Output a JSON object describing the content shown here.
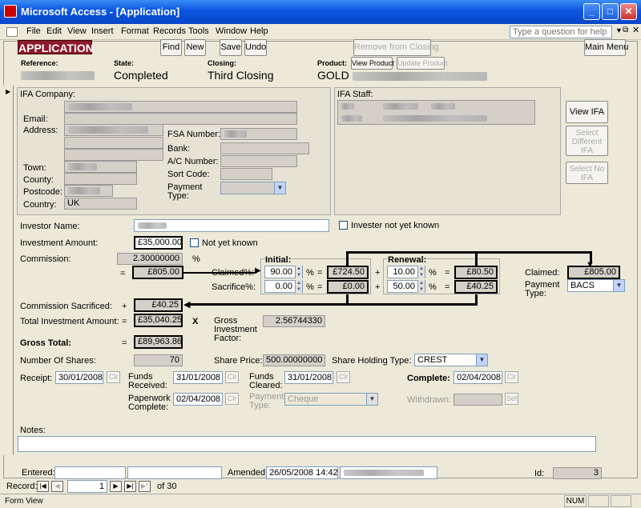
{
  "window": {
    "title": "Microsoft Access - [Application]"
  },
  "menu": [
    "File",
    "Edit",
    "View",
    "Insert",
    "Format",
    "Records",
    "Tools",
    "Window",
    "Help"
  ],
  "help_placeholder": "Type a question for help",
  "header": {
    "form_title": "APPLICATION",
    "find": "Find",
    "new": "New",
    "save": "Save",
    "undo": "Undo",
    "remove_closing": "Remove from Closing",
    "main_menu": "Main Menu",
    "reference_label": "Reference:",
    "reference_value": "GOLD1E5B08(1",
    "state_label": "State:",
    "state_value": "Completed",
    "closing_label": "Closing:",
    "closing_value": "Third Closing",
    "product_label": "Product:",
    "view_product": "View Product",
    "update_product": "Update Product",
    "product_value": "GOLD"
  },
  "ifa": {
    "company_label": "IFA Company:",
    "email_label": "Email:",
    "address_label": "Address:",
    "town_label": "Town:",
    "county_label": "County:",
    "postcode_label": "Postcode:",
    "country_label": "Country:",
    "country_value": "UK",
    "fsa_label": "FSA Number:",
    "bank_label": "Bank:",
    "ac_label": "A/C Number:",
    "sort_label": "Sort Code:",
    "payment_label": "Payment Type:",
    "staff_label": "IFA Staff:",
    "view_ifa": "View IFA",
    "select_diff": "Select Different IFA",
    "select_no": "Select No IFA"
  },
  "investor": {
    "name_label": "Investor Name:",
    "not_known": "Invester not yet known",
    "amount_label": "Investment Amount:",
    "amount_value": "£35,000.00",
    "amount_not_known": "Not yet known",
    "commission_label": "Commission:",
    "commission_value": "2.30000000",
    "percent": "%",
    "commission_amount": "£805.00",
    "eq": "=",
    "plus": "+",
    "x": "X",
    "claimed_pct_label": "Claimed%:",
    "sacrifice_pct_label": "Sacrifice%:",
    "initial_label": "Initial:",
    "renewal_label": "Renewal:",
    "init_claimed_pct": "90.00",
    "init_claimed_amt": "£724.50",
    "init_sac_pct": "0.00",
    "init_sac_amt": "£0.00",
    "ren_claimed_pct": "10.00",
    "ren_claimed_amt": "£80.50",
    "ren_sac_pct": "50.00",
    "ren_sac_amt": "£40.25",
    "claimed_label": "Claimed:",
    "claimed_value": "£805.00",
    "payment_type_label": "Payment Type:",
    "payment_type_value": "BACS",
    "comm_sac_label": "Commission Sacrificed:",
    "comm_sac_value": "£40.25",
    "total_label": "Total Investment Amount:",
    "total_value": "£35,040.25",
    "gif_label": "Gross Investment Factor:",
    "gif_value": "2.56744330",
    "gross_label": "Gross Total:",
    "gross_value": "£89,963.86",
    "shares_label": "Number Of Shares:",
    "shares_value": "70",
    "share_price_label": "Share Price:",
    "share_price_value": "500.00000000",
    "holding_label": "Share Holding Type:",
    "holding_value": "CREST"
  },
  "dates": {
    "receipt_label": "Receipt:",
    "receipt_value": "30/01/2008",
    "funds_recv_label": "Funds Received:",
    "funds_recv_value": "31/01/2008",
    "funds_clr_label": "Funds Cleared:",
    "funds_clr_value": "31/01/2008",
    "complete_label": "Complete:",
    "complete_value": "02/04/2008",
    "paperwork_label": "Paperwork Complete:",
    "paperwork_value": "02/04/2008",
    "payment_type_label": "Payment Type:",
    "payment_type_value": "Cheque",
    "withdrawn_label": "Withdrawn:",
    "clr": "Clr",
    "set": "Set"
  },
  "notes_label": "Notes:",
  "footer": {
    "entered_label": "Entered:",
    "amended_label": "Amended:",
    "amended_value": "26/05/2008 14:42",
    "id_label": "Id:",
    "id_value": "3"
  },
  "nav": {
    "record_label": "Record:",
    "current": "1",
    "of": "of  30"
  },
  "status": {
    "left": "Form View",
    "num": "NUM"
  }
}
